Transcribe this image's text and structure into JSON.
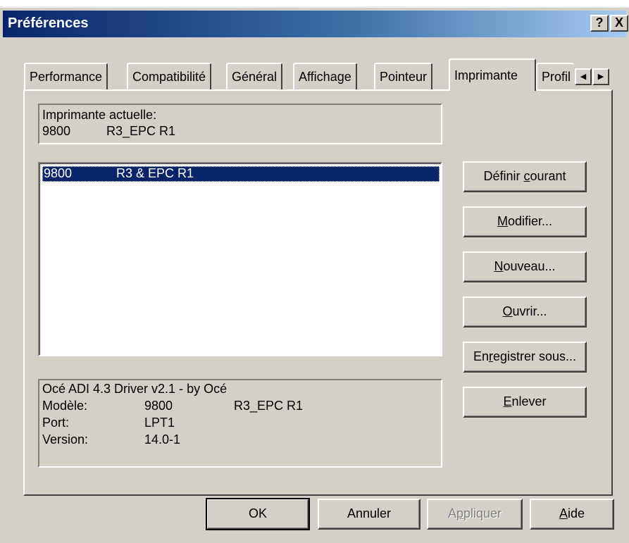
{
  "window": {
    "title": "Préférences",
    "help_glyph": "?",
    "close_glyph": "X"
  },
  "tabs": [
    {
      "label": "Performance"
    },
    {
      "label": "Compatibilité"
    },
    {
      "label": "Général"
    },
    {
      "label": "Affichage"
    },
    {
      "label": "Pointeur"
    },
    {
      "label": "Imprimante",
      "active": true
    },
    {
      "label": "Profil"
    }
  ],
  "tab_scroll": {
    "left": "◀",
    "right": "▶"
  },
  "current_printer": {
    "label": "Imprimante actuelle:",
    "model": "9800",
    "name": "R3_EPC R1"
  },
  "printer_list": [
    {
      "model": "9800",
      "name": "R3 & EPC R1",
      "selected": true
    }
  ],
  "buttons": {
    "set_current": {
      "pre": "Définir ",
      "key": "c",
      "post": "ourant"
    },
    "modify": {
      "pre": "",
      "key": "M",
      "post": "odifier..."
    },
    "new": {
      "pre": "",
      "key": "N",
      "post": "ouveau..."
    },
    "open": {
      "pre": "",
      "key": "O",
      "post": "uvrir..."
    },
    "save_as": {
      "pre": "En",
      "key": "r",
      "post": "egistrer sous..."
    },
    "remove": {
      "pre": "",
      "key": "E",
      "post": "nlever"
    }
  },
  "driver_info": {
    "driver": "Océ ADI 4.3 Driver v2.1 - by Océ",
    "model_label": "Modèle:",
    "model_value": "9800",
    "model_name": "R3_EPC R1",
    "port_label": "Port:",
    "port_value": "LPT1",
    "version_label": "Version:",
    "version_value": "14.0-1"
  },
  "footer": {
    "ok": "OK",
    "cancel": "Annuler",
    "apply": {
      "pre": "A",
      "key": "p",
      "post": "pliquer"
    },
    "help": {
      "pre": "",
      "key": "A",
      "post": "ide"
    }
  }
}
